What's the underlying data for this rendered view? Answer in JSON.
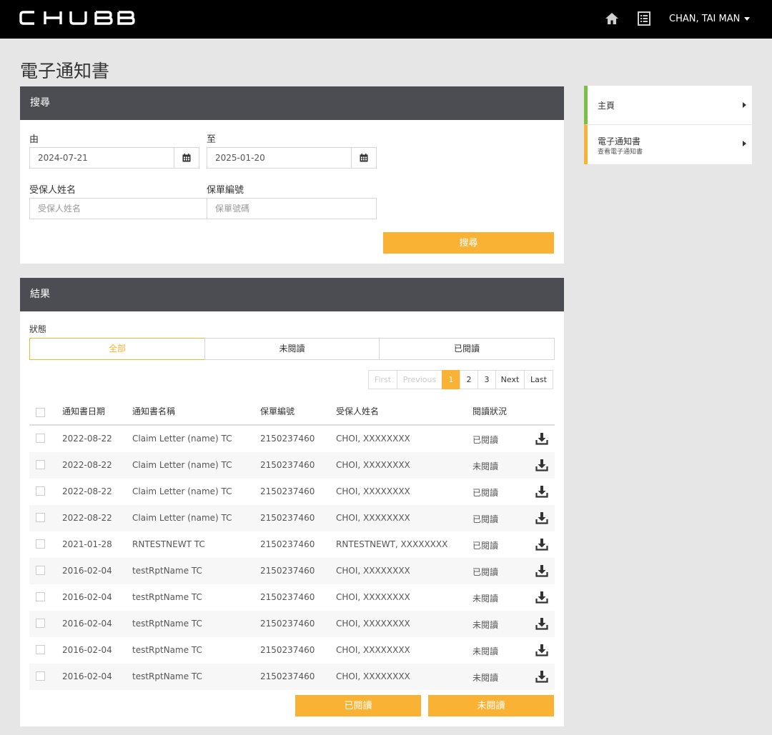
{
  "header": {
    "brand": "CHUBB",
    "user_name": "CHAN, TAI MAN",
    "icons": [
      "home-icon",
      "document-list-icon",
      "caret-down-icon"
    ]
  },
  "page_title": "電子通知書",
  "search": {
    "title": "搜尋",
    "from_label": "由",
    "from_value": "2024-07-21",
    "to_label": "至",
    "to_value": "2025-01-20",
    "insured_label": "受保人姓名",
    "insured_placeholder": "受保人姓名",
    "policy_label": "保單編號",
    "policy_placeholder": "保單號碼",
    "search_button": "搜尋"
  },
  "results": {
    "title": "結果",
    "status_label": "狀態",
    "tabs": [
      {
        "label": "全部",
        "active": true
      },
      {
        "label": "未閱讀",
        "active": false
      },
      {
        "label": "已閱讀",
        "active": false
      }
    ],
    "pagination": {
      "first": "First",
      "previous": "Previous",
      "pages": [
        "1",
        "2",
        "3"
      ],
      "current": "1",
      "next": "Next",
      "last": "Last"
    },
    "columns": [
      "通知書日期",
      "通知書名稱",
      "保單編號",
      "受保人姓名",
      "閱讀狀況"
    ],
    "rows": [
      {
        "date": "2022-08-22",
        "name": "Claim Letter (name) TC",
        "policy": "2150237460",
        "insured": "CHOI, XXXXXXXX",
        "status": "已閱讀"
      },
      {
        "date": "2022-08-22",
        "name": "Claim Letter (name) TC",
        "policy": "2150237460",
        "insured": "CHOI, XXXXXXXX",
        "status": "未閱讀"
      },
      {
        "date": "2022-08-22",
        "name": "Claim Letter (name) TC",
        "policy": "2150237460",
        "insured": "CHOI, XXXXXXXX",
        "status": "已閱讀"
      },
      {
        "date": "2022-08-22",
        "name": "Claim Letter (name) TC",
        "policy": "2150237460",
        "insured": "CHOI, XXXXXXXX",
        "status": "已閱讀"
      },
      {
        "date": "2021-01-28",
        "name": "RNTESTNEWT TC",
        "policy": "2150237460",
        "insured": "RNTESTNEWT, XXXXXXXX",
        "status": "已閱讀"
      },
      {
        "date": "2016-02-04",
        "name": "testRptName TC",
        "policy": "2150237460",
        "insured": "CHOI, XXXXXXXX",
        "status": "已閱讀"
      },
      {
        "date": "2016-02-04",
        "name": "testRptName TC",
        "policy": "2150237460",
        "insured": "CHOI, XXXXXXXX",
        "status": "未閱讀"
      },
      {
        "date": "2016-02-04",
        "name": "testRptName TC",
        "policy": "2150237460",
        "insured": "CHOI, XXXXXXXX",
        "status": "未閱讀"
      },
      {
        "date": "2016-02-04",
        "name": "testRptName TC",
        "policy": "2150237460",
        "insured": "CHOI, XXXXXXXX",
        "status": "未閱讀"
      },
      {
        "date": "2016-02-04",
        "name": "testRptName TC",
        "policy": "2150237460",
        "insured": "CHOI, XXXXXXXX",
        "status": "未閱讀"
      }
    ],
    "mark_read_button": "已閱讀",
    "mark_unread_button": "未閱讀"
  },
  "sidebar": {
    "items": [
      {
        "title": "主頁",
        "subtitle": "",
        "accent": "#7ac143"
      },
      {
        "title": "電子通知書",
        "subtitle": "查看電子通知書",
        "accent": "#f9b233"
      }
    ]
  },
  "colors": {
    "accent": "#f9b233",
    "panel_header": "#4b4d52",
    "topbar": "#000000"
  }
}
